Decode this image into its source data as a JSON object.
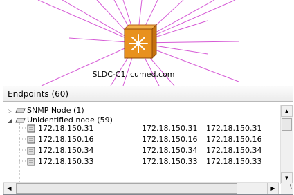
{
  "node": {
    "label": "SLDC-C1.icumed.com",
    "icon": "switch-router-icon"
  },
  "panel": {
    "title": "Endpoints (60)"
  },
  "tree": {
    "groups": [
      {
        "label": "SNMP Node (1)",
        "expanded": false,
        "icon": "snmp-node-icon"
      },
      {
        "label": "Unidentified node (59)",
        "expanded": true,
        "icon": "unidentified-node-icon"
      }
    ],
    "rows": [
      {
        "name": "172.18.150.31",
        "col2": "172.18.150.31",
        "col3": "172.18.150.31"
      },
      {
        "name": "172.18.150.16",
        "col2": "172.18.150.16",
        "col3": "172.18.150.16"
      },
      {
        "name": "172.18.150.34",
        "col2": "172.18.150.34",
        "col3": "172.18.150.34"
      },
      {
        "name": "172.18.150.33",
        "col2": "172.18.150.33",
        "col3": "172.18.150.33"
      }
    ]
  },
  "colors": {
    "link_line": "#d14fd1",
    "node_orange": "#e8911e"
  },
  "edge_glyph": "\\"
}
